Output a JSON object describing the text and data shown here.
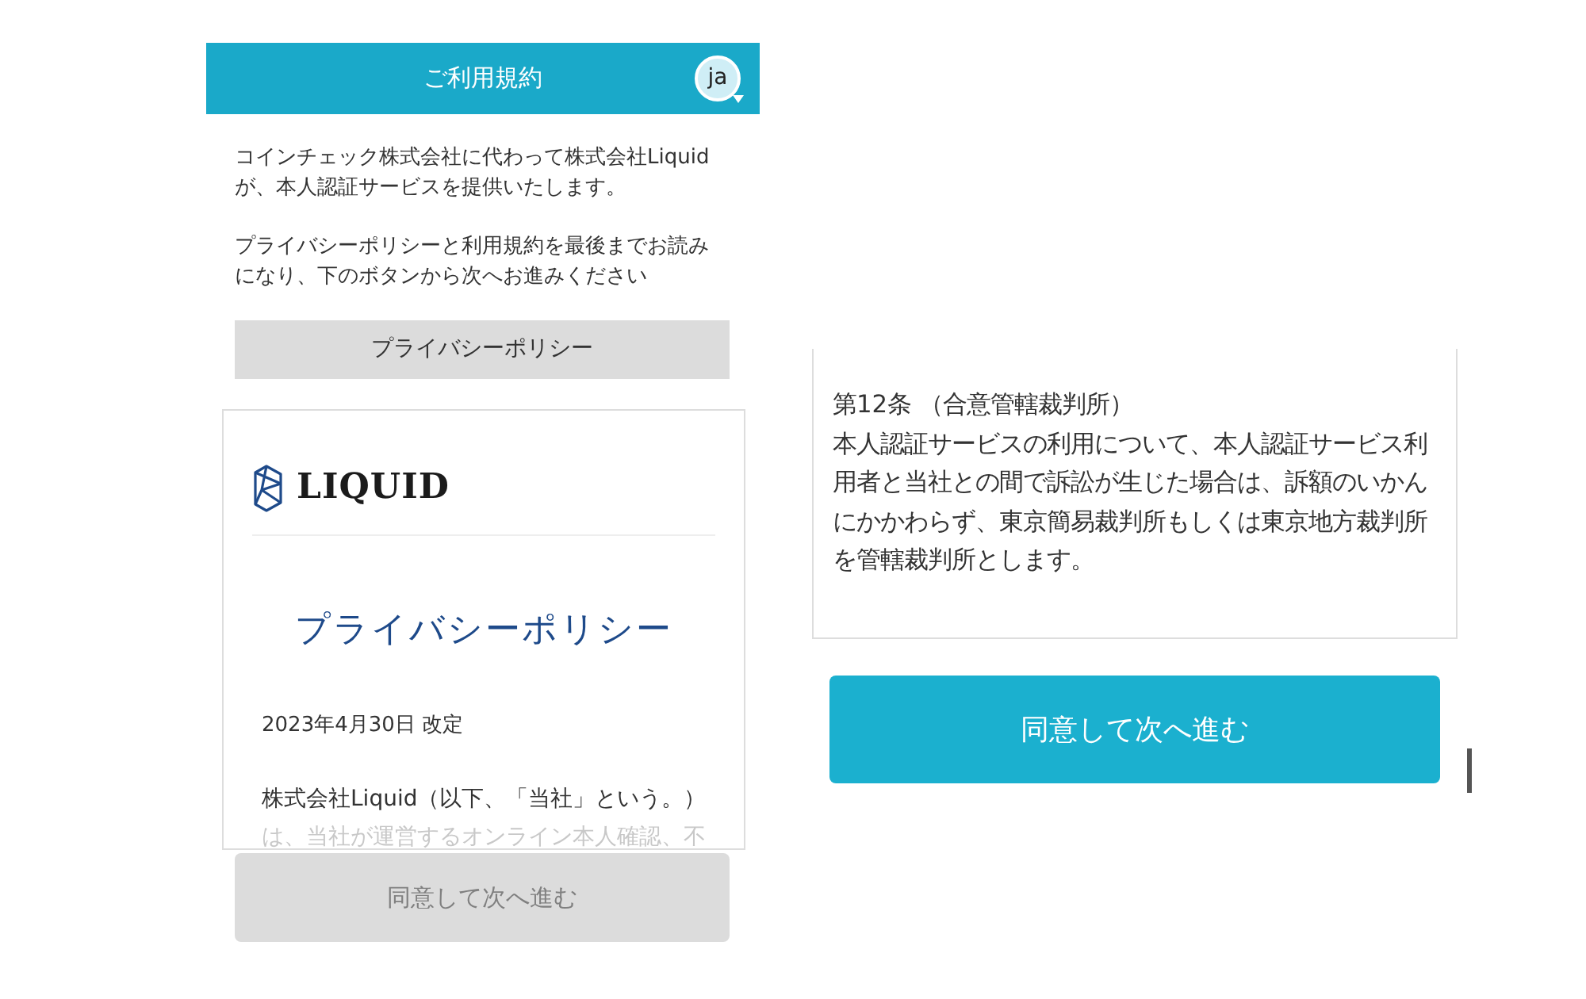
{
  "header": {
    "title": "ご利用規約",
    "avatar": "ja"
  },
  "intro": [
    "コインチェック株式会社に代わって株式会社Liquidが、本人認証サービスを提供いたします。",
    "プライバシーポリシーと利用規約を最後までお読みになり、下のボタンから次へお進みください"
  ],
  "policy_button": "プライバシーポリシー",
  "document": {
    "logo": "LIQUID",
    "title": "プライバシーポリシー",
    "date": "2023年4月30日 改定",
    "lines": [
      {
        "text": "株式会社Liquid（以下、「当社」という。）",
        "faded": false
      },
      {
        "text": "は、当社が運営するオンライン本人確認、不",
        "faded": true
      }
    ]
  },
  "left_action": {
    "label": "同意して次へ進む",
    "disabled": true
  },
  "terms": {
    "heading": "第12条 （合意管轄裁判所）",
    "body": "本人認証サービスの利用について、本人認証サービス利用者と当社との間で訴訟が生じた場合は、訴額のいかんにかかわらず、東京簡易裁判所もしくは東京地方裁判所を管轄裁判所とします。"
  },
  "right_action": {
    "label": "同意して次へ進む",
    "disabled": false
  }
}
